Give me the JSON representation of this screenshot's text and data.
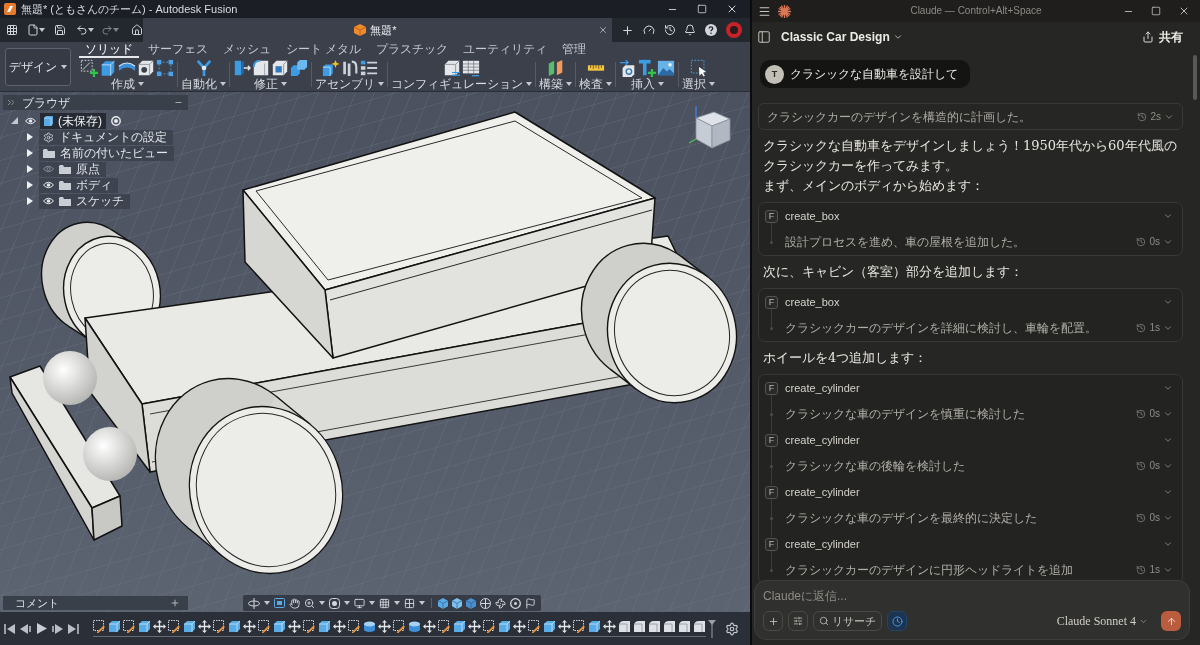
{
  "fusion": {
    "title": "無題* (ともさんのチーム) - Autodesk Fusion",
    "document_tab": "無題*",
    "workspace": "デザイン",
    "ribbon_tabs": [
      {
        "label": "ソリッド",
        "selected": true
      },
      {
        "label": "サーフェス",
        "selected": false
      },
      {
        "label": "メッシュ",
        "selected": false
      },
      {
        "label": "シート メタル",
        "selected": false
      },
      {
        "label": "プラスチック",
        "selected": false
      },
      {
        "label": "ユーティリティ",
        "selected": false
      },
      {
        "label": "管理",
        "selected": false
      }
    ],
    "ribbon_groups": [
      "作成",
      "自動化",
      "修正",
      "アセンブリ",
      "コンフィギュレーション",
      "構築",
      "検査",
      "挿入",
      "選択"
    ],
    "browser": {
      "title": "ブラウザ",
      "root": {
        "label": "(未保存)",
        "expanded": true,
        "visible": true,
        "selected": true,
        "children": [
          {
            "label": "ドキュメントの設定",
            "kind": "settings",
            "expanded": false,
            "selected": false
          },
          {
            "label": "名前の付いたビュー",
            "kind": "folder",
            "expanded": false,
            "selected": false
          },
          {
            "label": "原点",
            "kind": "folder",
            "expanded": false,
            "visible": false,
            "selected": false
          },
          {
            "label": "ボディ",
            "kind": "folder",
            "expanded": false,
            "visible": true,
            "selected": false
          },
          {
            "label": "スケッチ",
            "kind": "folder",
            "expanded": false,
            "visible": true,
            "selected": false
          }
        ]
      }
    },
    "comments": "コメント"
  },
  "claude": {
    "title": "Claude — Control+Alt+Space",
    "conversation": "Classic Car Design",
    "share": "共有",
    "user_message": {
      "avatar": "T",
      "text": "クラシックな自動車を設計して"
    },
    "thread": [
      {
        "kind": "thinking",
        "text": "クラシックカーのデザインを構造的に計画した。",
        "duration": "2s"
      },
      {
        "kind": "paragraph",
        "text": "クラシックな自動車をデザインしましょう！1950年代から60年代風のクラシックカーを作ってみます。"
      },
      {
        "kind": "paragraph",
        "text": "まず、メインのボディから始めます："
      },
      {
        "kind": "tools",
        "calls": [
          {
            "badge": "F",
            "name": "create_box",
            "summary": "設計プロセスを進め、車の屋根を追加した。",
            "duration": "0s"
          }
        ]
      },
      {
        "kind": "paragraph",
        "text": "次に、キャビン（客室）部分を追加します："
      },
      {
        "kind": "tools",
        "calls": [
          {
            "badge": "F",
            "name": "create_box",
            "summary": "クラシックカーのデザインを詳細に検討し、車輪を配置。",
            "duration": "1s"
          }
        ]
      },
      {
        "kind": "paragraph",
        "text": "ホイールを4つ追加します："
      },
      {
        "kind": "tools",
        "calls": [
          {
            "badge": "F",
            "name": "create_cylinder",
            "summary": "クラシックな車のデザインを慎重に検討した",
            "duration": "0s"
          },
          {
            "badge": "F",
            "name": "create_cylinder",
            "summary": "クラシックな車の後輪を検討した",
            "duration": "0s"
          },
          {
            "badge": "F",
            "name": "create_cylinder",
            "summary": "クラシックな車のデザインを最終的に決定した",
            "duration": "0s"
          },
          {
            "badge": "F",
            "name": "create_cylinder",
            "summary": "クラシックカーのデザインに円形ヘッドライトを追加",
            "duration": "1s"
          }
        ]
      }
    ],
    "composer": {
      "placeholder": "Claudeに返信...",
      "research": "リサーチ",
      "clock_toggle_on": true,
      "model": "Claude Sonnet 4"
    }
  }
}
